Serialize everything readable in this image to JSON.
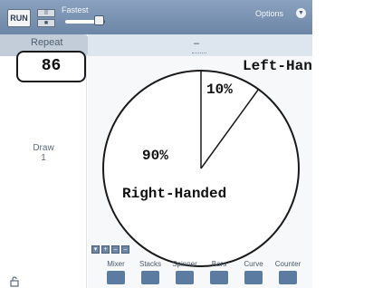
{
  "toolbar": {
    "run_label": "RUN",
    "pause_glyph": "II",
    "stop_glyph": "■",
    "speed_label": "Fastest",
    "speed_level": 0.95,
    "options_label": "Options",
    "options_glyph": "▼"
  },
  "repeat": {
    "label": "Repeat",
    "value": "86"
  },
  "draw": {
    "label": "Draw",
    "value": "1"
  },
  "main": {
    "header_text": "–"
  },
  "pie": {
    "slices": [
      {
        "name": "Left-Handed",
        "percent_label": "10%",
        "fraction": 0.1
      },
      {
        "name": "Right-Handed",
        "percent_label": "90%",
        "fraction": 0.9
      }
    ]
  },
  "mini_buttons": [
    "▾",
    "+",
    "–",
    "–"
  ],
  "devices": [
    {
      "label": "Mixer",
      "icon": "mixer-icon"
    },
    {
      "label": "Stacks",
      "icon": "stacks-icon"
    },
    {
      "label": "Spinner",
      "icon": "spinner-icon"
    },
    {
      "label": "Bars",
      "icon": "bars-icon"
    },
    {
      "label": "Curve",
      "icon": "curve-icon"
    },
    {
      "label": "Counter",
      "icon": "counter-icon"
    }
  ],
  "colors": {
    "toolbar": "#7f97b6",
    "header": "#dde5ee",
    "pie_fill": "#ffffff",
    "pie_stroke": "#1a1a1a",
    "device_icon": "#5b7ba0"
  }
}
